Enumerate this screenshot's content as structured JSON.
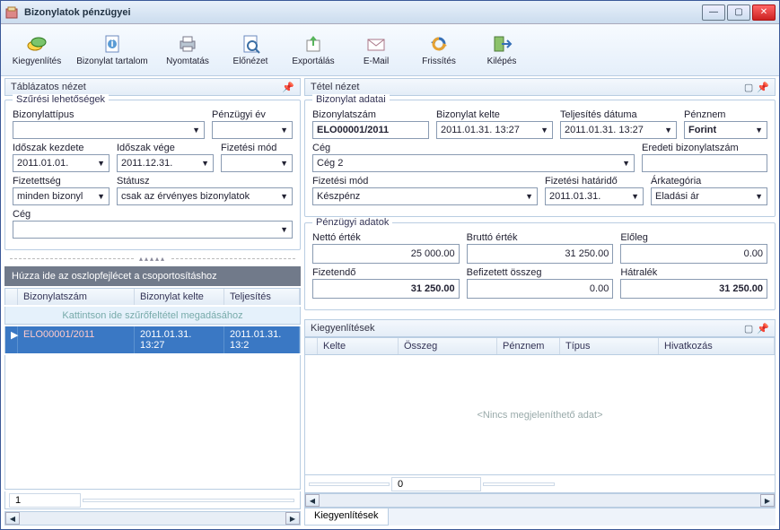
{
  "window": {
    "title": "Bizonylatok pénzügyei"
  },
  "toolbar": {
    "kiegyenlites": "Kiegyenlítés",
    "bizonylat_tartalom": "Bizonylat tartalom",
    "nyomtatas": "Nyomtatás",
    "elonezet": "Előnézet",
    "exportalas": "Exportálás",
    "email": "E-Mail",
    "frissites": "Frissítés",
    "kilepes": "Kilépés"
  },
  "left_panel_title": "Táblázatos nézet",
  "right_panel_title": "Tétel nézet",
  "filters": {
    "legend": "Szűrési lehetőségek",
    "bizonylattipus_label": "Bizonylattípus",
    "penzugyi_ev_label": "Pénzügyi év",
    "idoszak_kezdete_label": "Időszak kezdete",
    "idoszak_vege_label": "Időszak vége",
    "fizetesi_mod_label": "Fizetési mód",
    "fizetettseg_label": "Fizetettség",
    "statusz_label": "Státusz",
    "ceg_label": "Cég",
    "idoszak_kezdete": "2011.01.01.",
    "idoszak_vege": "2011.12.31.",
    "fizetettseg": "minden bizonyl",
    "statusz": "csak az érvényes bizonylatok"
  },
  "group_hint": "Húzza ide az oszlopfejlécet a csoportosításhoz",
  "grid": {
    "col1": "Bizonylatszám",
    "col2": "Bizonylat kelte",
    "col3": "Teljesítés",
    "filter_hint": "Kattintson ide szűrőfeltétel megadásához",
    "row1": {
      "bizonylatszam": "ELO00001/2011",
      "kelte": "2011.01.31.  13:27",
      "teljesites": "2011.01.31.  13:2"
    },
    "footer_count": "1"
  },
  "doc": {
    "legend": "Bizonylat adatai",
    "bizonylatszam_label": "Bizonylatszám",
    "bizonylat_kelte_label": "Bizonylat kelte",
    "teljesites_label": "Teljesítés dátuma",
    "penznem_label": "Pénznem",
    "ceg_label": "Cég",
    "eredeti_label": "Eredeti bizonylatszám",
    "fizetesi_mod_label": "Fizetési mód",
    "fizetesi_hatar_label": "Fizetési határidő",
    "arkategoria_label": "Árkategória",
    "bizonylatszam": "ELO00001/2011",
    "kelte": "2011.01.31.  13:27",
    "teljesites": "2011.01.31.  13:27",
    "penznem": "Forint",
    "ceg": "Cég 2",
    "fizetesi_mod": "Készpénz",
    "fizetesi_hatar": "2011.01.31.",
    "arkategoria": "Eladási ár"
  },
  "fin": {
    "legend": "Pénzügyi adatok",
    "netto_label": "Nettó érték",
    "brutto_label": "Bruttó érték",
    "eloleg_label": "Előleg",
    "fizetendo_label": "Fizetendő",
    "befizetett_label": "Befizetett összeg",
    "hatralek_label": "Hátralék",
    "netto": "25 000.00",
    "brutto": "31 250.00",
    "eloleg": "0.00",
    "fizetendo": "31 250.00",
    "befizetett": "0.00",
    "hatralek": "31 250.00"
  },
  "ke": {
    "title": "Kiegyenlítések",
    "col_kelte": "Kelte",
    "col_osszeg": "Összeg",
    "col_penznem": "Pénznem",
    "col_tipus": "Típus",
    "col_hivatkozas": "Hivatkozás",
    "empty": "<Nincs megjeleníthető adat>",
    "sum": "0",
    "tab": "Kiegyenlítések"
  }
}
